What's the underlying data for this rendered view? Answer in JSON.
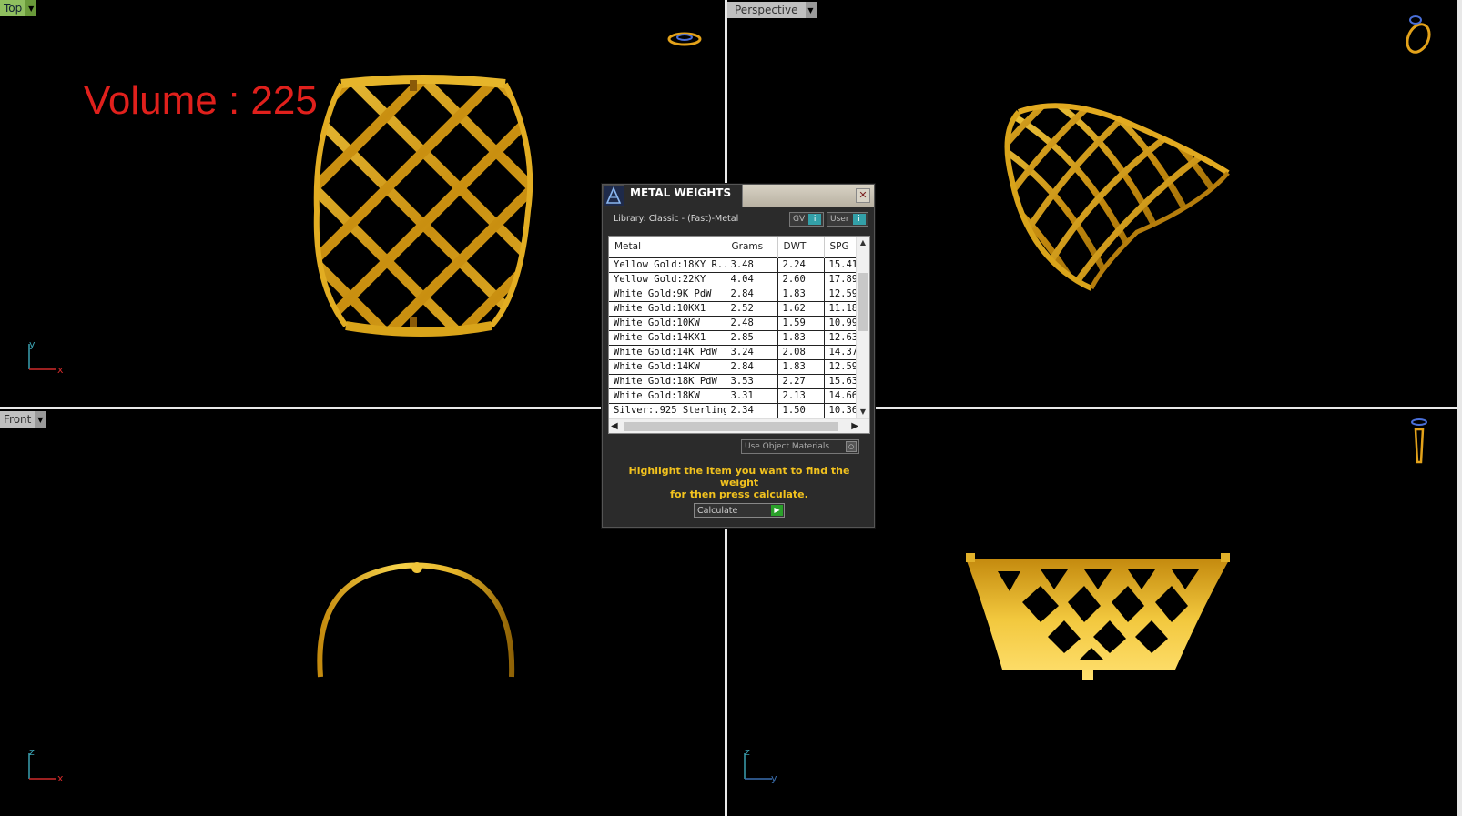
{
  "viewports": {
    "top": {
      "label": "Top"
    },
    "perspective": {
      "label": "Perspective"
    },
    "front": {
      "label": "Front"
    }
  },
  "overlay": {
    "volume_text": "Volume : 225"
  },
  "axes": {
    "top": {
      "x": "x",
      "y": "y"
    },
    "front": {
      "x": "x",
      "z": "z"
    },
    "right": {
      "y": "y",
      "z": "z"
    }
  },
  "dialog": {
    "title": "METAL WEIGHTS",
    "library": "Library: Classic - (Fast)-Metal",
    "gv_label": "GV",
    "user_label": "User",
    "columns": [
      "Metal",
      "Grams",
      "DWT",
      "SPG"
    ],
    "rows": [
      [
        "Yellow Gold:18KY R...",
        "3.48",
        "2.24",
        "15.41"
      ],
      [
        "Yellow Gold:22KY",
        "4.04",
        "2.60",
        "17.89"
      ],
      [
        "White Gold:9K PdW",
        "2.84",
        "1.83",
        "12.59"
      ],
      [
        "White Gold:10KX1",
        "2.52",
        "1.62",
        "11.18"
      ],
      [
        "White Gold:10KW",
        "2.48",
        "1.59",
        "10.99"
      ],
      [
        "White Gold:14KX1",
        "2.85",
        "1.83",
        "12.63"
      ],
      [
        "White Gold:14K PdW",
        "3.24",
        "2.08",
        "14.37"
      ],
      [
        "White Gold:14KW",
        "2.84",
        "1.83",
        "12.59"
      ],
      [
        "White Gold:18K PdW",
        "3.53",
        "2.27",
        "15.63"
      ],
      [
        "White Gold:18KW",
        "3.31",
        "2.13",
        "14.66"
      ],
      [
        "Silver:.925 Sterling",
        "2.34",
        "1.50",
        "10.36"
      ]
    ],
    "use_materials_label": "Use Object Materials",
    "hint_line1": "Highlight the item you want to find the weight",
    "hint_line2": "for then press calculate.",
    "calculate_label": "Calculate"
  },
  "colors": {
    "gold": "#d9a41a",
    "volume_red": "#e0201c",
    "hint_yellow": "#f2c21e"
  }
}
